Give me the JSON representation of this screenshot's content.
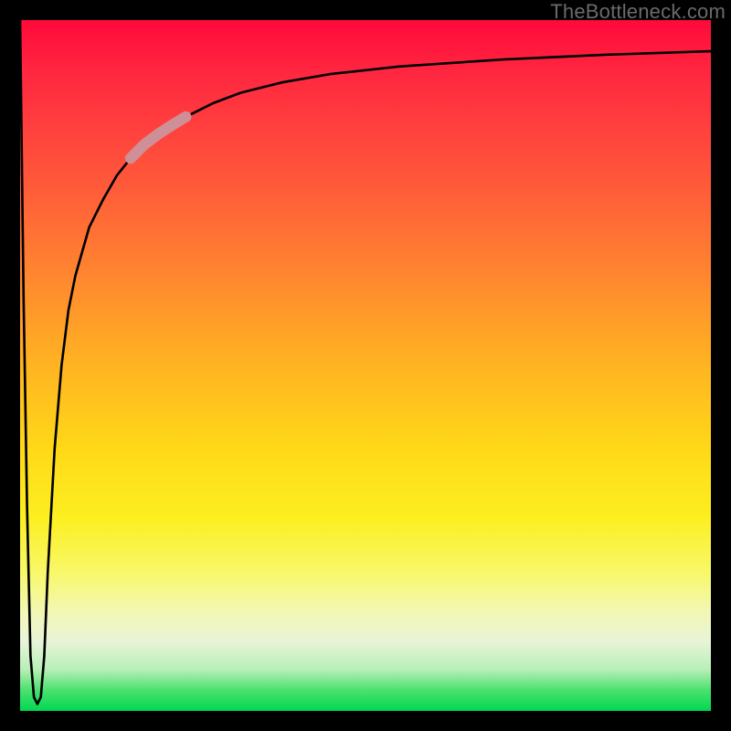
{
  "watermark": "TheBottleneck.com",
  "chart_data": {
    "type": "line",
    "title": "",
    "xlabel": "",
    "ylabel": "",
    "xlim": [
      0,
      100
    ],
    "ylim": [
      0,
      100
    ],
    "grid": false,
    "legend": false,
    "background_gradient": {
      "orientation": "vertical",
      "stops": [
        {
          "pos": 0.0,
          "color": "#ff0a3a"
        },
        {
          "pos": 0.38,
          "color": "#ff8a2e"
        },
        {
          "pos": 0.62,
          "color": "#ffd818"
        },
        {
          "pos": 0.86,
          "color": "#f2f7b8"
        },
        {
          "pos": 1.0,
          "color": "#00d852"
        }
      ]
    },
    "series": [
      {
        "name": "bottleneck-curve",
        "color": "#000000",
        "x": [
          0.0,
          0.5,
          1.0,
          1.5,
          2.0,
          2.5,
          3.0,
          3.5,
          4.0,
          5.0,
          6.0,
          7.0,
          8.0,
          10.0,
          12.0,
          14.0,
          16.0,
          18.0,
          20.0,
          24.0,
          28.0,
          32.0,
          38.0,
          45.0,
          55.0,
          70.0,
          85.0,
          100.0
        ],
        "y": [
          100,
          60,
          30,
          8,
          2,
          1,
          2,
          8,
          20,
          38,
          50,
          58,
          63,
          70,
          74,
          77.5,
          80,
          82,
          83.5,
          86,
          88,
          89.5,
          91,
          92.2,
          93.3,
          94.3,
          95.0,
          95.5
        ]
      },
      {
        "name": "highlight-segment",
        "color": "#cf8f96",
        "thickness": "bold",
        "x": [
          16.0,
          18.0,
          20.0,
          22.0,
          24.0
        ],
        "y": [
          80.0,
          82.0,
          83.5,
          84.8,
          86.0
        ]
      }
    ],
    "annotations": []
  }
}
